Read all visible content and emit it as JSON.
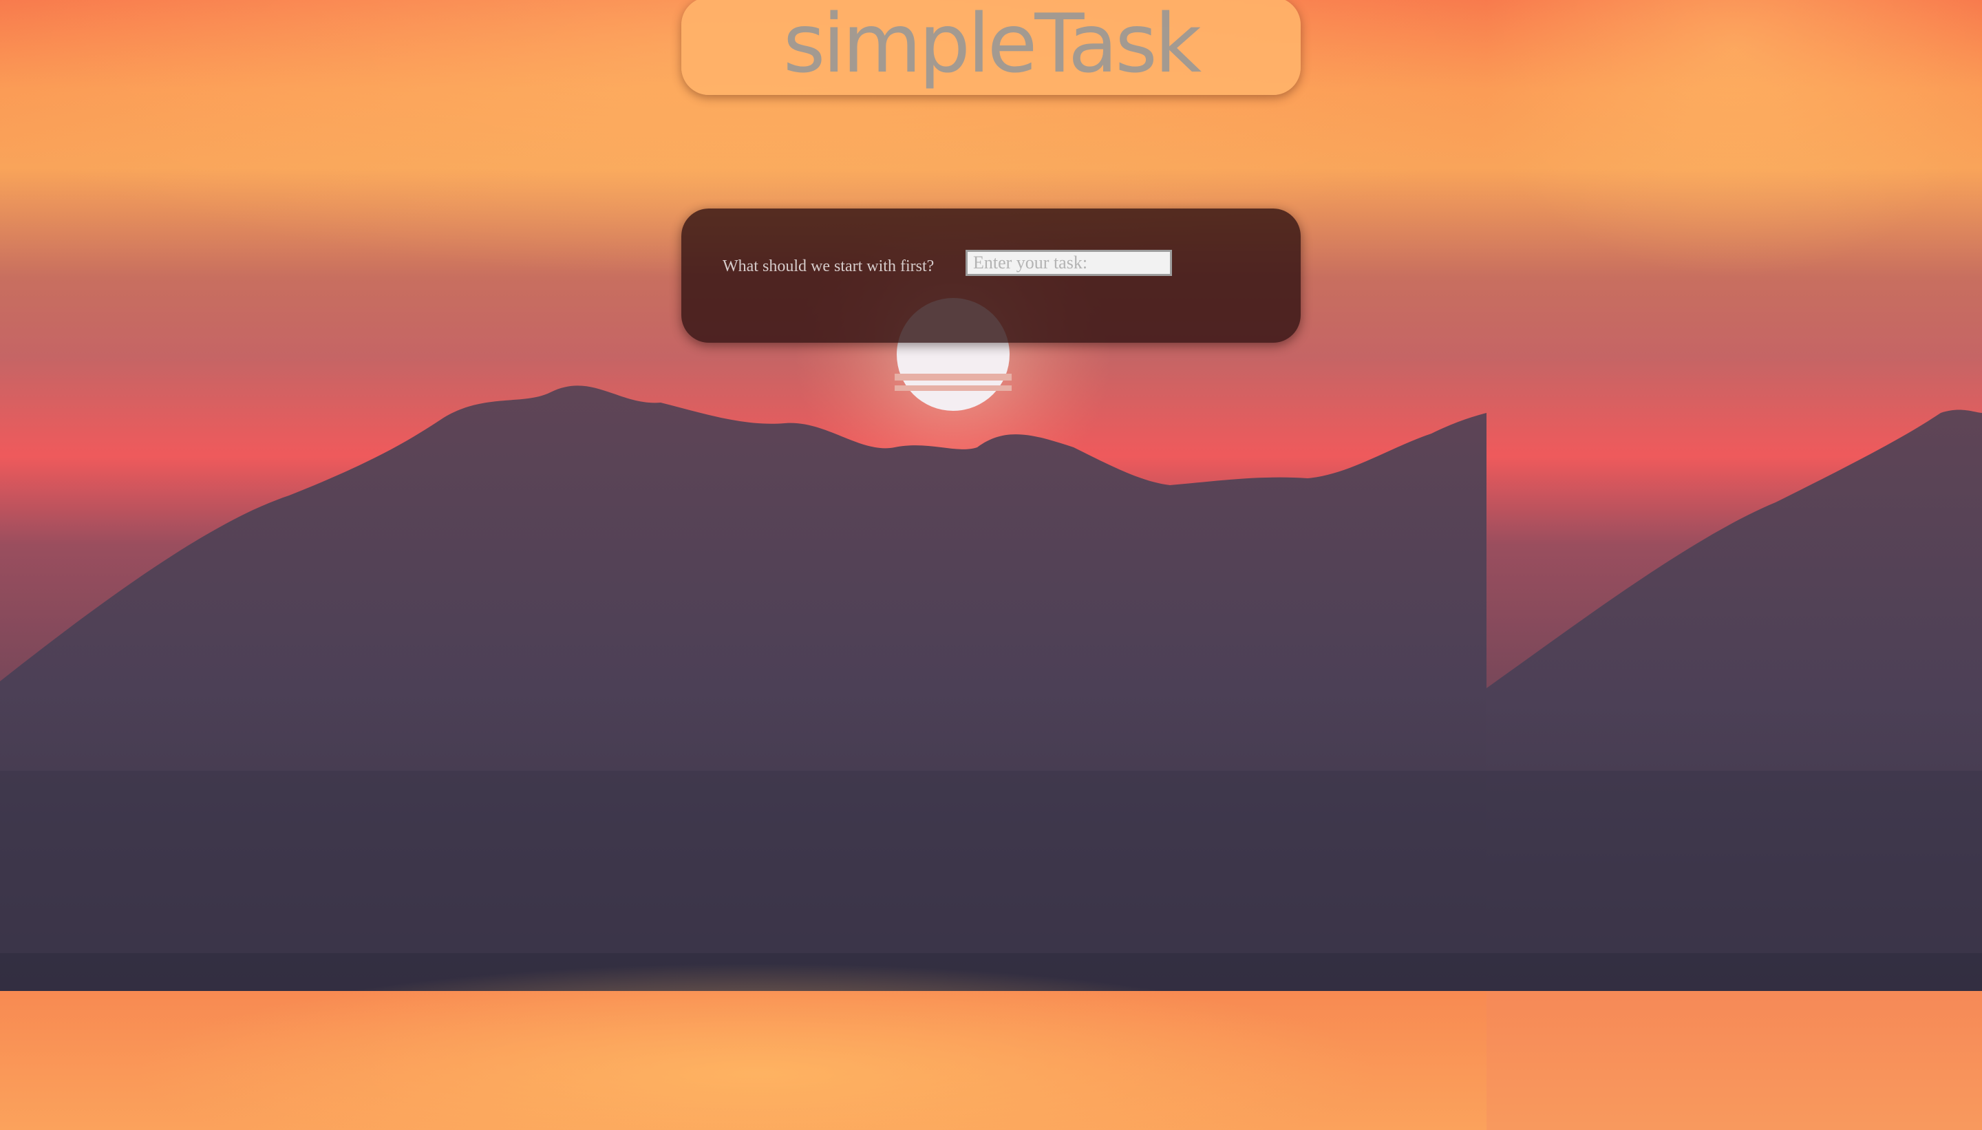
{
  "app": {
    "title": "simpleTask"
  },
  "task_form": {
    "prompt": "What should we start with first?",
    "input_placeholder": "Enter your task:",
    "input_value": ""
  },
  "theme": {
    "header_panel_color": "#ffb269",
    "task_panel_color": "#301212",
    "title_color": "#969696",
    "prompt_color": "#d6cccb"
  }
}
